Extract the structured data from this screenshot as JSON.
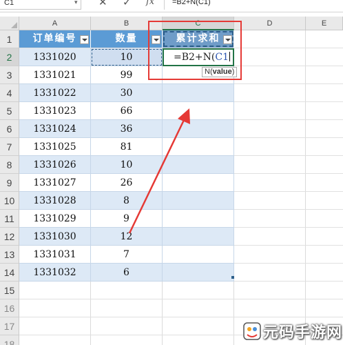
{
  "formula_bar": {
    "name_box": "C1",
    "cancel_icon": "close-icon",
    "confirm_icon": "check-icon",
    "fx_label": "fx",
    "formula": "=B2+N(C1)"
  },
  "columns": [
    "A",
    "B",
    "C",
    "D",
    "E"
  ],
  "table": {
    "headers": [
      "订单编号",
      "数量",
      "累计求和"
    ],
    "rows": [
      {
        "id": "1331020",
        "qty": "10"
      },
      {
        "id": "1331021",
        "qty": "99"
      },
      {
        "id": "1331022",
        "qty": "30"
      },
      {
        "id": "1331023",
        "qty": "66"
      },
      {
        "id": "1331024",
        "qty": "36"
      },
      {
        "id": "1331025",
        "qty": "81"
      },
      {
        "id": "1331026",
        "qty": "10"
      },
      {
        "id": "1331027",
        "qty": "26"
      },
      {
        "id": "1331028",
        "qty": "8"
      },
      {
        "id": "1331029",
        "qty": "9"
      },
      {
        "id": "1331030",
        "qty": "12"
      },
      {
        "id": "1331031",
        "qty": "7"
      },
      {
        "id": "1331032",
        "qty": "6"
      }
    ]
  },
  "editing_cell": {
    "prefix": "=B2+N(",
    "ref": "C1",
    "suffix": ")"
  },
  "tooltip": {
    "func": "N(",
    "arg": "value",
    "close": ")"
  },
  "row_numbers": [
    "1",
    "2",
    "3",
    "4",
    "5",
    "6",
    "7",
    "8",
    "9",
    "10",
    "11",
    "12",
    "13",
    "14",
    "15",
    "16",
    "17",
    "18"
  ],
  "watermark": {
    "text": "元码手游网"
  },
  "colors": {
    "accent": "#217346",
    "header_blue": "#5b9bd5",
    "band": "#dde9f6",
    "annotation_red": "#e53935"
  }
}
